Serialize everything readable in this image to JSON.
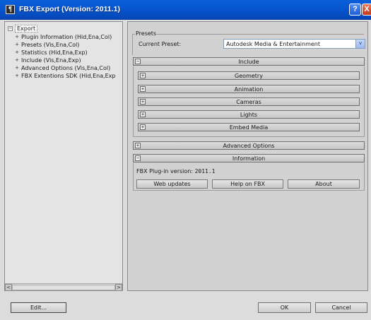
{
  "window": {
    "title": "FBX Export (Version: 2011.1)",
    "icon_glyph": "¶",
    "help_glyph": "?",
    "close_glyph": "X"
  },
  "tree": {
    "root": {
      "toggle": "−",
      "label": "Export"
    },
    "items": [
      {
        "toggle": "+",
        "label": "Plugin Information (Hid,Ena,Col)"
      },
      {
        "toggle": "+",
        "label": "Presets (Vis,Ena,Col)"
      },
      {
        "toggle": "+",
        "label": "Statistics (Hid,Ena,Exp)"
      },
      {
        "toggle": "+",
        "label": "Include (Vis,Ena,Exp)"
      },
      {
        "toggle": "+",
        "label": "Advanced Options (Vis,Ena,Col)"
      },
      {
        "toggle": "+",
        "label": "FBX Extentions SDK (Hid,Ena,Exp"
      }
    ],
    "scroll_left": "<",
    "scroll_right": ">"
  },
  "presets": {
    "group_title": "Presets",
    "current_label": "Current Preset:",
    "current_value": "Autodesk Media & Entertainment",
    "dropdown_glyph": "v"
  },
  "include": {
    "toggle": "−",
    "title": "Include",
    "subsections": [
      {
        "toggle": "+",
        "title": "Geometry"
      },
      {
        "toggle": "+",
        "title": "Animation"
      },
      {
        "toggle": "+",
        "title": "Cameras"
      },
      {
        "toggle": "+",
        "title": "Lights"
      },
      {
        "toggle": "+",
        "title": "Embed Media"
      }
    ]
  },
  "advanced": {
    "toggle": "+",
    "title": "Advanced Options"
  },
  "information": {
    "toggle": "−",
    "title": "Information",
    "version_label": "FBX Plug-in version:",
    "version_value": "2011.1",
    "buttons": [
      "Web updates",
      "Help on FBX",
      "About"
    ]
  },
  "footer": {
    "edit_label": "Edit...",
    "ok_label": "OK",
    "cancel_label": "Cancel"
  }
}
